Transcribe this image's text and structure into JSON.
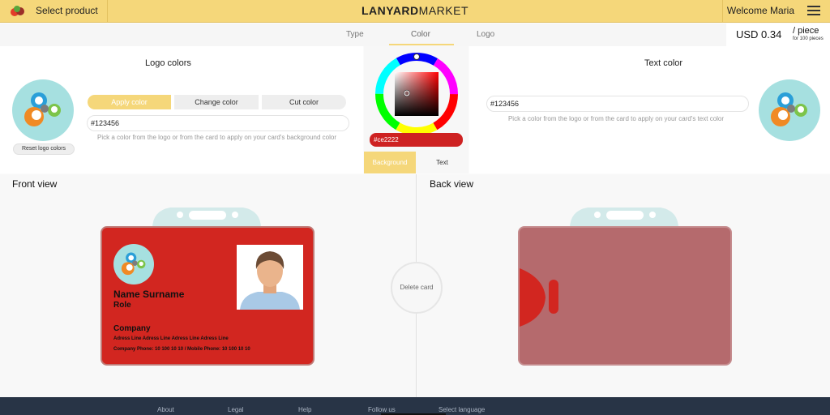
{
  "header": {
    "select_product": "Select product",
    "brand_bold": "LANYARD",
    "brand_rest": "MARKET",
    "welcome": "Welcome Maria"
  },
  "tabs": [
    {
      "label": "Type"
    },
    {
      "label": "Color",
      "active": true
    },
    {
      "label": "Logo"
    }
  ],
  "price": {
    "amount": "USD 0.34",
    "unit": "/ piece",
    "note": "for 100 pieces"
  },
  "logo_colors": {
    "title": "Logo colors",
    "reset_label": "Reset logo colors",
    "apply_label": "Apply color",
    "change_label": "Change color",
    "cut_label": "Cut color",
    "hex_value": "#123456",
    "hint": "Pick a color from the logo or from the card to apply on your card's background color"
  },
  "picker": {
    "hex_value": "#ce2222",
    "color": "#ce2222",
    "mode_background": "Background",
    "mode_text": "Text"
  },
  "text_color": {
    "title": "Text color",
    "hex_value": "#123456",
    "hint": "Pick a color from the logo or from the card to apply on your card's text color"
  },
  "front_view": {
    "title": "Front view",
    "card_color": "#d22620",
    "name": "Name Surname",
    "role": "Role",
    "company": "Company",
    "address": "Adress Line Adress Line Adress Line Adress Line",
    "phone": "Company Phone: 10 100 10 10 / Mobile Phone: 10 100 10 10"
  },
  "back_view": {
    "title": "Back view",
    "card_color": "#b56a6d"
  },
  "delete_label": "Delete card",
  "footer": {
    "links": [
      "About",
      "Legal",
      "Help",
      "Follow us",
      "Select language"
    ]
  },
  "colors": {
    "accent": "#f5d77a",
    "footer_bg": "#283446"
  }
}
